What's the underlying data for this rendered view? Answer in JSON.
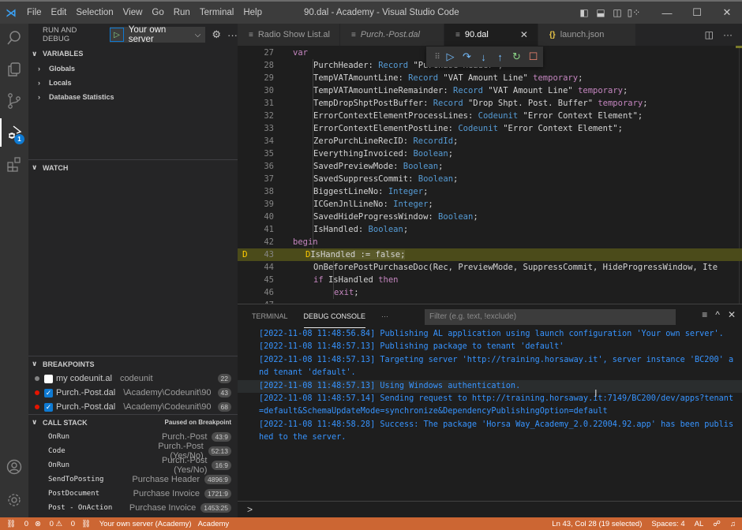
{
  "titlebar": {
    "menu": [
      "File",
      "Edit",
      "Selection",
      "View",
      "Go",
      "Run",
      "Terminal",
      "Help"
    ],
    "title": "90.dal - Academy - Visual Studio Code",
    "logo_icon": "vscode-logo-icon"
  },
  "activitybar": {
    "items": [
      {
        "name": "search",
        "icon": "search-icon"
      },
      {
        "name": "explorer",
        "icon": "files-icon"
      },
      {
        "name": "source-control",
        "icon": "source-control-icon"
      },
      {
        "name": "run-and-debug",
        "icon": "debug-icon",
        "badge": "1"
      },
      {
        "name": "extensions",
        "icon": "extensions-icon"
      }
    ],
    "bottom": [
      {
        "name": "accounts",
        "icon": "account-icon"
      },
      {
        "name": "manage",
        "icon": "gear-icon"
      }
    ]
  },
  "sidebar": {
    "title": "RUN AND DEBUG",
    "config": "Your own server",
    "variables": {
      "title": "VARIABLES",
      "items": [
        "Globals",
        "Locals",
        "Database Statistics"
      ]
    },
    "watch": {
      "title": "WATCH"
    },
    "breakpoints": {
      "title": "BREAKPOINTS",
      "items": [
        {
          "name": "my codeunit.al",
          "path": "codeunit",
          "line": "22",
          "enabled": false,
          "dot_color": "#848484"
        },
        {
          "name": "Purch.-Post.dal",
          "path": "\\Academy\\Codeunit\\90",
          "line": "43",
          "enabled": true,
          "dot_color": "#e51400"
        },
        {
          "name": "Purch.-Post.dal",
          "path": "\\Academy\\Codeunit\\90",
          "line": "68",
          "enabled": true,
          "dot_color": "#e51400"
        }
      ]
    },
    "callstack": {
      "title": "CALL STACK",
      "status": "Paused on Breakpoint",
      "frames": [
        {
          "fn": "OnRun",
          "source": "Purch.-Post",
          "pos": "43:9"
        },
        {
          "fn": "Code",
          "source": "Purch.-Post (Yes/No)",
          "pos": "52:13"
        },
        {
          "fn": "OnRun",
          "source": "Purch.-Post (Yes/No)",
          "pos": "16:9"
        },
        {
          "fn": "SendToPosting",
          "source": "Purchase Header",
          "pos": "4896:9"
        },
        {
          "fn": "PostDocument",
          "source": "Purchase Invoice",
          "pos": "1721:9"
        },
        {
          "fn": "Post - OnAction",
          "source": "Purchase Invoice",
          "pos": "1453:25"
        }
      ]
    }
  },
  "tabs": [
    {
      "label": "Radio Show List.al",
      "italic": false,
      "active": false,
      "icon": "file-lines-icon"
    },
    {
      "label": "Purch.-Post.dal",
      "italic": true,
      "active": false,
      "icon": "file-lines-icon"
    },
    {
      "label": "90.dal",
      "italic": false,
      "active": true,
      "icon": "file-lines-icon"
    },
    {
      "label": "launch.json",
      "italic": false,
      "active": false,
      "icon": "json-braces-icon"
    }
  ],
  "editor": {
    "current_line": 43,
    "lines": [
      {
        "n": "27",
        "indent": 1,
        "tokens": [
          [
            "k",
            "var"
          ]
        ]
      },
      {
        "n": "28",
        "indent": 2,
        "tokens": [
          [
            "p",
            "PurchHeader: "
          ],
          [
            "t",
            "Record"
          ],
          [
            "p",
            " \"Purchase Header\";"
          ]
        ]
      },
      {
        "n": "29",
        "indent": 2,
        "tokens": [
          [
            "p",
            "TempVATAmountLine: "
          ],
          [
            "t",
            "Record"
          ],
          [
            "p",
            " \"VAT Amount Line\" "
          ],
          [
            "k",
            "temporary"
          ],
          [
            "p",
            ";"
          ]
        ]
      },
      {
        "n": "30",
        "indent": 2,
        "tokens": [
          [
            "p",
            "TempVATAmountLineRemainder: "
          ],
          [
            "t",
            "Record"
          ],
          [
            "p",
            " \"VAT Amount Line\" "
          ],
          [
            "k",
            "temporary"
          ],
          [
            "p",
            ";"
          ]
        ]
      },
      {
        "n": "31",
        "indent": 2,
        "tokens": [
          [
            "p",
            "TempDropShptPostBuffer: "
          ],
          [
            "t",
            "Record"
          ],
          [
            "p",
            " \"Drop Shpt. Post. Buffer\" "
          ],
          [
            "k",
            "temporary"
          ],
          [
            "p",
            ";"
          ]
        ]
      },
      {
        "n": "32",
        "indent": 2,
        "tokens": [
          [
            "p",
            "ErrorContextElementProcessLines: "
          ],
          [
            "t",
            "Codeunit"
          ],
          [
            "p",
            " \"Error Context Element\";"
          ]
        ]
      },
      {
        "n": "33",
        "indent": 2,
        "tokens": [
          [
            "p",
            "ErrorContextElementPostLine: "
          ],
          [
            "t",
            "Codeunit"
          ],
          [
            "p",
            " \"Error Context Element\";"
          ]
        ]
      },
      {
        "n": "34",
        "indent": 2,
        "tokens": [
          [
            "p",
            "ZeroPurchLineRecID: "
          ],
          [
            "t",
            "RecordId"
          ],
          [
            "p",
            ";"
          ]
        ]
      },
      {
        "n": "35",
        "indent": 2,
        "tokens": [
          [
            "p",
            "EverythingInvoiced: "
          ],
          [
            "t",
            "Boolean"
          ],
          [
            "p",
            ";"
          ]
        ]
      },
      {
        "n": "36",
        "indent": 2,
        "tokens": [
          [
            "p",
            "SavedPreviewMode: "
          ],
          [
            "t",
            "Boolean"
          ],
          [
            "p",
            ";"
          ]
        ]
      },
      {
        "n": "37",
        "indent": 2,
        "tokens": [
          [
            "p",
            "SavedSuppressCommit: "
          ],
          [
            "t",
            "Boolean"
          ],
          [
            "p",
            ";"
          ]
        ]
      },
      {
        "n": "38",
        "indent": 2,
        "tokens": [
          [
            "p",
            "BiggestLineNo: "
          ],
          [
            "t",
            "Integer"
          ],
          [
            "p",
            ";"
          ]
        ]
      },
      {
        "n": "39",
        "indent": 2,
        "tokens": [
          [
            "p",
            "ICGenJnlLineNo: "
          ],
          [
            "t",
            "Integer"
          ],
          [
            "p",
            ";"
          ]
        ]
      },
      {
        "n": "40",
        "indent": 2,
        "tokens": [
          [
            "p",
            "SavedHideProgressWindow: "
          ],
          [
            "t",
            "Boolean"
          ],
          [
            "p",
            ";"
          ]
        ]
      },
      {
        "n": "41",
        "indent": 2,
        "tokens": [
          [
            "p",
            "IsHandled: "
          ],
          [
            "t",
            "Boolean"
          ],
          [
            "p",
            ";"
          ]
        ]
      },
      {
        "n": "42",
        "indent": 1,
        "tokens": [
          [
            "k",
            "begin"
          ]
        ]
      },
      {
        "n": "43",
        "indent": 2,
        "tokens": [
          [
            "p",
            "IsHandled := false;"
          ]
        ]
      },
      {
        "n": "44",
        "indent": 2,
        "tokens": [
          [
            "p",
            "OnBeforePostPurchaseDoc(Rec, PreviewMode, SuppressCommit, HideProgressWindow, Ite"
          ]
        ]
      },
      {
        "n": "45",
        "indent": 2,
        "tokens": [
          [
            "k",
            "if"
          ],
          [
            "p",
            " IsHandled "
          ],
          [
            "k",
            "then"
          ]
        ]
      },
      {
        "n": "46",
        "indent": 3,
        "tokens": [
          [
            "k",
            "exit"
          ],
          [
            "p",
            ";"
          ]
        ]
      },
      {
        "n": "47",
        "indent": 0,
        "tokens": []
      }
    ]
  },
  "debug_toolbar": {
    "buttons": [
      {
        "name": "continue",
        "icon": "continue-icon",
        "glyph": "▷",
        "color": "#75beff"
      },
      {
        "name": "step-over",
        "icon": "step-over-icon",
        "glyph": "↷",
        "color": "#75beff"
      },
      {
        "name": "step-into",
        "icon": "step-into-icon",
        "glyph": "↓",
        "color": "#75beff"
      },
      {
        "name": "step-out",
        "icon": "step-out-icon",
        "glyph": "↑",
        "color": "#75beff"
      },
      {
        "name": "restart",
        "icon": "restart-icon",
        "glyph": "↻",
        "color": "#89d185"
      },
      {
        "name": "stop",
        "icon": "stop-icon",
        "glyph": "☐",
        "color": "#f48771"
      }
    ]
  },
  "panel": {
    "tabs": [
      "TERMINAL",
      "DEBUG CONSOLE"
    ],
    "active_tab": "DEBUG CONSOLE",
    "filter_placeholder": "Filter (e.g. text, !exclude)",
    "console": [
      "[2022-11-08 11:48:56.84] Publishing AL application using launch configuration 'Your own server'.",
      "[2022-11-08 11:48:57.13] Publishing package to tenant 'default'",
      "[2022-11-08 11:48:57.13] Targeting server 'http://training.horsaway.it', server instance 'BC200' and tenant 'default'.",
      "[2022-11-08 11:48:57.13] Using Windows authentication.",
      "[2022-11-08 11:48:57.14] Sending request to http://training.horsaway.it:7149/BC200/dev/apps?tenant=default&SchemaUpdateMode=synchronize&DependencyPublishingOption=default",
      "[2022-11-08 11:48:58.28] Success: The package 'Horsa Way_Academy_2.0.22004.92.app' has been published to the server."
    ],
    "prompt": ">"
  },
  "statusbar": {
    "debug_count": "0",
    "errors": "0",
    "warnings": "0",
    "launch": "Your own server (Academy)",
    "workspace": "Academy",
    "position": "Ln 43, Col 28 (19 selected)",
    "spaces": "Spaces: 4",
    "language": "AL",
    "color": "#cc6633"
  }
}
